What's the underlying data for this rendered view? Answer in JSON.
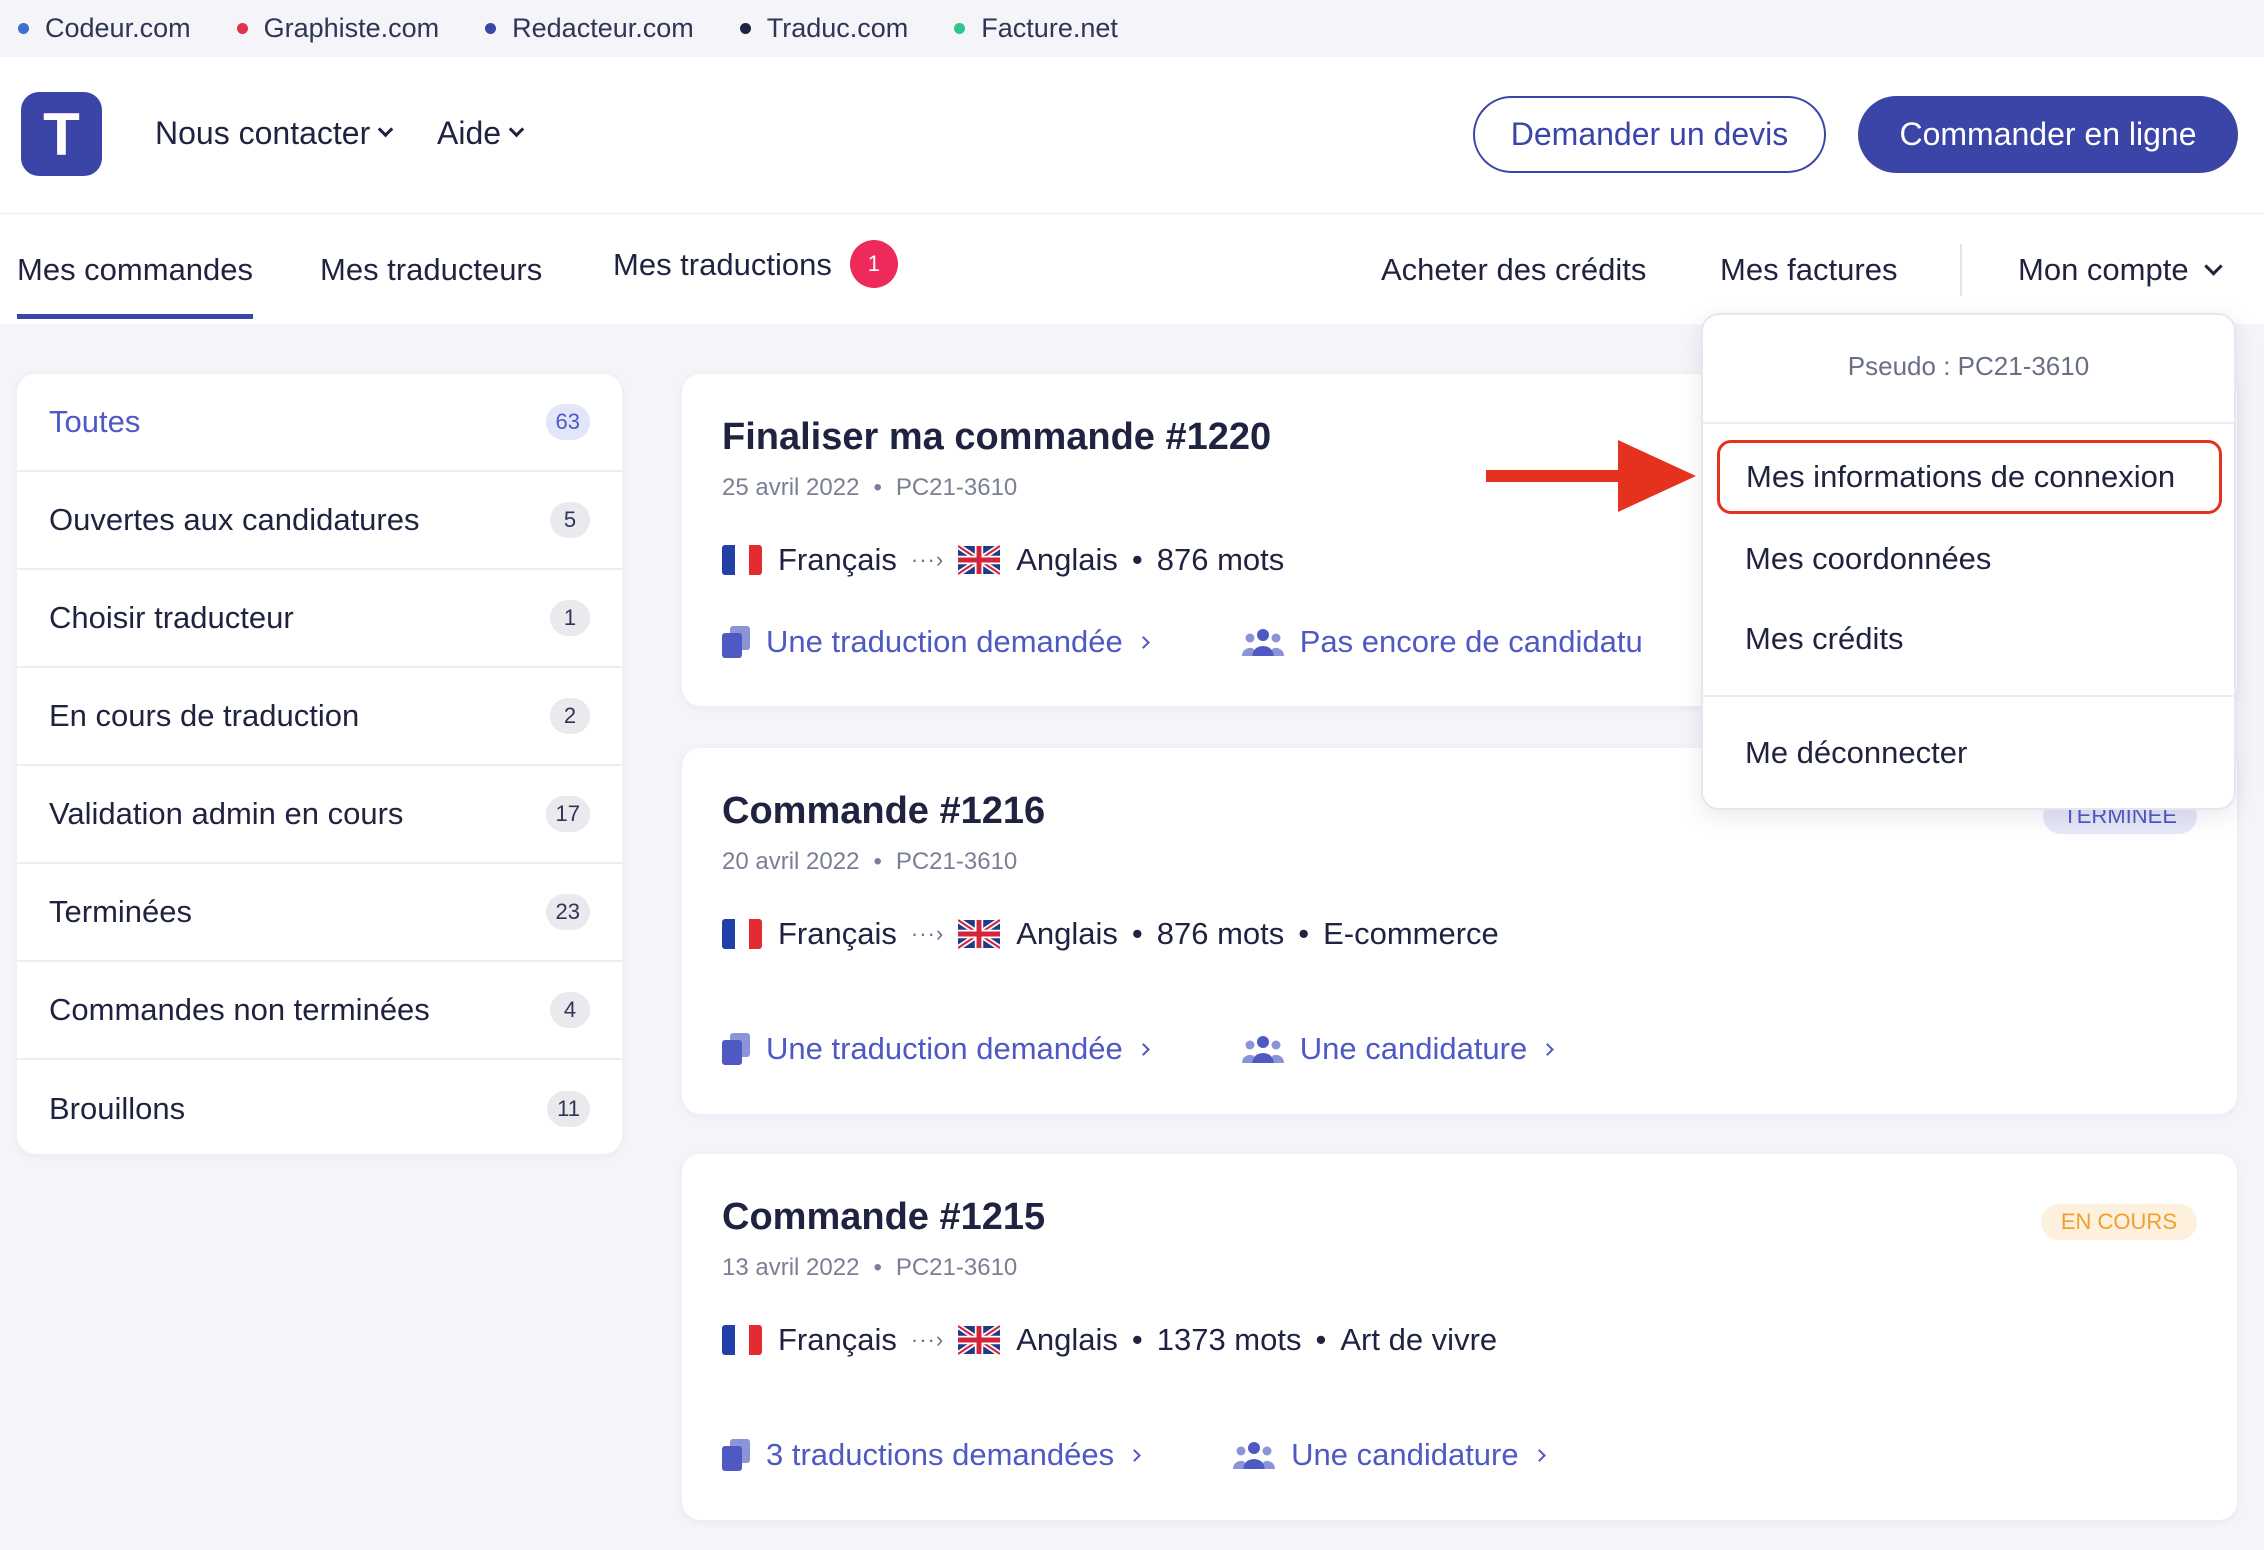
{
  "network": [
    {
      "label": "Codeur.com",
      "color": "#3b6fd1"
    },
    {
      "label": "Graphiste.com",
      "color": "#e0334a"
    },
    {
      "label": "Redacteur.com",
      "color": "#3b45a8"
    },
    {
      "label": "Traduc.com",
      "color": "#1f2340"
    },
    {
      "label": "Facture.net",
      "color": "#2fc48a"
    }
  ],
  "header": {
    "logo_letter": "T",
    "menu": {
      "contact": "Nous contacter",
      "help": "Aide"
    },
    "quote_button": "Demander un devis",
    "order_button": "Commander en ligne"
  },
  "tabs": {
    "orders": "Mes commandes",
    "translators": "Mes traducteurs",
    "translations": "Mes traductions",
    "translations_badge": "1",
    "credits": "Acheter des crédits",
    "invoices": "Mes factures",
    "account": "Mon compte"
  },
  "sidebar": {
    "items": [
      {
        "label": "Toutes",
        "count": "63"
      },
      {
        "label": "Ouvertes aux candidatures",
        "count": "5"
      },
      {
        "label": "Choisir traducteur",
        "count": "1"
      },
      {
        "label": "En cours de traduction",
        "count": "2"
      },
      {
        "label": "Validation admin en cours",
        "count": "17"
      },
      {
        "label": "Terminées",
        "count": "23"
      },
      {
        "label": "Commandes non terminées",
        "count": "4"
      },
      {
        "label": "Brouillons",
        "count": "11"
      }
    ]
  },
  "orders": [
    {
      "title": "Finaliser ma commande #1220",
      "date": "25 avril 2022",
      "user": "PC21-3610",
      "from": "Français",
      "to": "Anglais",
      "words": "876 mots",
      "theme": "",
      "status": "",
      "link1": "Une traduction demandée",
      "link2": "Pas encore de candidatu"
    },
    {
      "title": "Commande #1216",
      "date": "20 avril 2022",
      "user": "PC21-3610",
      "from": "Français",
      "to": "Anglais",
      "words": "876 mots",
      "theme": "E-commerce",
      "status": "TERMINEE",
      "link1": "Une traduction demandée",
      "link2": "Une candidature"
    },
    {
      "title": "Commande #1215",
      "date": "13 avril 2022",
      "user": "PC21-3610",
      "from": "Français",
      "to": "Anglais",
      "words": "1373 mots",
      "theme": "Art de vivre",
      "status": "EN COURS",
      "link1": "3 traductions demandées",
      "link2": "Une candidature"
    }
  ],
  "account_menu": {
    "pseudo": "Pseudo : PC21-3610",
    "login_info": "Mes informations de connexion",
    "contact_details": "Mes coordonnées",
    "credits": "Mes crédits",
    "logout": "Me déconnecter"
  },
  "colors": {
    "accent": "#3b45a8",
    "link": "#4e59c4",
    "badge": "#ee2a5a",
    "highlight": "#e5321f",
    "status_done_bg": "#e6e7f8",
    "status_done_fg": "#4e59c4",
    "status_progress_bg": "#fdf0dc",
    "status_progress_fg": "#f0a030"
  },
  "icons": {
    "doc": "document-copy-icon",
    "people": "users-group-icon"
  }
}
